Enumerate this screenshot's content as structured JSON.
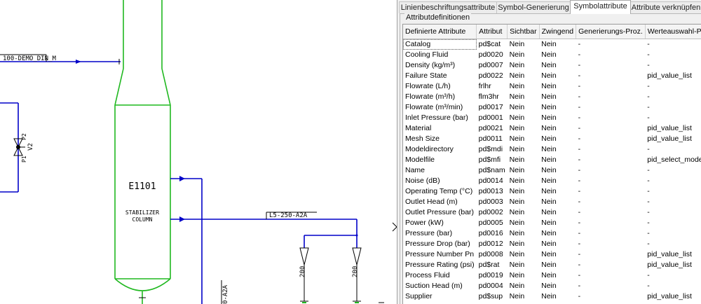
{
  "drawing": {
    "line_label_top": "100-DEMO_DIN_M",
    "valve_label_v2": "V2",
    "valve_label_p2": "P2",
    "valve_label_p1": "P1",
    "equipment_tag": "E1101",
    "equipment_desc_line1": "STABILIZER",
    "equipment_desc_line2": "COLUMN",
    "line_label_right": "L5-250-A2A",
    "reducer_label_left": "200",
    "reducer_label_right": "200",
    "line_label_vertical": "0-A2A"
  },
  "panel": {
    "tabs": [
      {
        "label": "Linienbeschriftungsattribute",
        "active": false
      },
      {
        "label": "Symbol-Generierung",
        "active": false
      },
      {
        "label": "Symbolattribute",
        "active": true
      },
      {
        "label": "Attribute verknüpfen",
        "active": false
      }
    ],
    "group_title": "Attributdefinitionen",
    "columns": [
      "Definierte Attribute",
      "Attribut",
      "Sichtbar",
      "Zwingend",
      "Generierungs-Proz.",
      "Werteauswahl-Proz."
    ],
    "rows": [
      [
        "Catalog",
        "pd$cat",
        "Nein",
        "Nein",
        "-",
        "-"
      ],
      [
        "Cooling Fluid",
        "pd0020",
        "Nein",
        "Nein",
        "-",
        "-"
      ],
      [
        "Density (kg/m³)",
        "pd0007",
        "Nein",
        "Nein",
        "-",
        "-"
      ],
      [
        "Failure State",
        "pd0022",
        "Nein",
        "Nein",
        "-",
        "pid_value_list"
      ],
      [
        "Flowrate (L/h)",
        "frlhr",
        "Nein",
        "Nein",
        "-",
        "-"
      ],
      [
        "Flowrate (m³/h)",
        "flm3hr",
        "Nein",
        "Nein",
        "-",
        "-"
      ],
      [
        "Flowrate (m³/min)",
        "pd0017",
        "Nein",
        "Nein",
        "-",
        "-"
      ],
      [
        "Inlet Pressure (bar)",
        "pd0001",
        "Nein",
        "Nein",
        "-",
        "-"
      ],
      [
        "Material",
        "pd0021",
        "Nein",
        "Nein",
        "-",
        "pid_value_list"
      ],
      [
        "Mesh Size",
        "pd0011",
        "Nein",
        "Nein",
        "-",
        "pid_value_list"
      ],
      [
        "Modeldirectory",
        "pd$mdi",
        "Nein",
        "Nein",
        "-",
        "-"
      ],
      [
        "Modelfile",
        "pd$mfi",
        "Nein",
        "Nein",
        "-",
        "pid_select_model_file"
      ],
      [
        "Name",
        "pd$nam",
        "Nein",
        "Nein",
        "-",
        "-"
      ],
      [
        "Noise (dB)",
        "pd0014",
        "Nein",
        "Nein",
        "-",
        "-"
      ],
      [
        "Operating Temp (°C)",
        "pd0013",
        "Nein",
        "Nein",
        "-",
        "-"
      ],
      [
        "Outlet Head (m)",
        "pd0003",
        "Nein",
        "Nein",
        "-",
        "-"
      ],
      [
        "Outlet Pressure (bar)",
        "pd0002",
        "Nein",
        "Nein",
        "-",
        "-"
      ],
      [
        "Power (kW)",
        "pd0005",
        "Nein",
        "Nein",
        "-",
        "-"
      ],
      [
        "Pressure (bar)",
        "pd0016",
        "Nein",
        "Nein",
        "-",
        "-"
      ],
      [
        "Pressure Drop (bar)",
        "pd0012",
        "Nein",
        "Nein",
        "-",
        "-"
      ],
      [
        "Pressure Number Pn",
        "pd0008",
        "Nein",
        "Nein",
        "-",
        "pid_value_list"
      ],
      [
        "Pressure Rating (psi)",
        "pd$rat",
        "Nein",
        "Nein",
        "-",
        "pid_value_list"
      ],
      [
        "Process Fluid",
        "pd0019",
        "Nein",
        "Nein",
        "-",
        "-"
      ],
      [
        "Suction Head (m)",
        "pd0004",
        "Nein",
        "Nein",
        "-",
        "-"
      ],
      [
        "Supplier",
        "pd$sup",
        "Nein",
        "Nein",
        "-",
        "pid_value_list"
      ]
    ]
  }
}
